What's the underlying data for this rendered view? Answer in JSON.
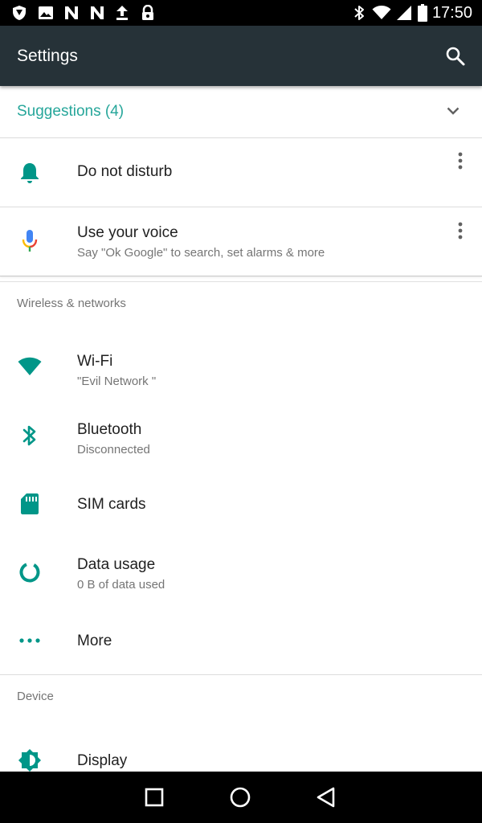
{
  "status_bar": {
    "time": "17:50",
    "left_icons": [
      "shield-icon",
      "image-icon",
      "n-notification-icon",
      "n-notification-icon",
      "upload-icon",
      "lock-icon"
    ],
    "right_icons": [
      "bluetooth-icon",
      "wifi-icon",
      "signal-icon",
      "battery-icon"
    ]
  },
  "app_bar": {
    "title": "Settings",
    "search_icon": "search-icon"
  },
  "suggestions": {
    "label": "Suggestions (4)",
    "items": [
      {
        "title": "Do not disturb",
        "icon": "bell-icon"
      },
      {
        "title": "Use your voice",
        "subtitle": "Say \"Ok Google\" to search, set alarms & more",
        "icon": "microphone-icon"
      }
    ]
  },
  "sections": [
    {
      "header": "Wireless & networks",
      "items": [
        {
          "title": "Wi-Fi",
          "subtitle": "\"Evil Network \"",
          "icon": "wifi-icon"
        },
        {
          "title": "Bluetooth",
          "subtitle": "Disconnected",
          "icon": "bluetooth-icon"
        },
        {
          "title": "SIM cards",
          "icon": "sim-card-icon"
        },
        {
          "title": "Data usage",
          "subtitle": "0 B of data used",
          "icon": "data-usage-icon"
        },
        {
          "title": "More",
          "icon": "more-horizontal-icon"
        }
      ]
    },
    {
      "header": "Device",
      "items": [
        {
          "title": "Display",
          "icon": "brightness-icon"
        }
      ]
    }
  ],
  "nav_bar": {
    "buttons": [
      "recents-icon",
      "home-icon",
      "back-icon"
    ]
  },
  "colors": {
    "accent": "#26a69a",
    "icon_teal": "#009688",
    "app_bar": "#263238",
    "status_bar": "#000000"
  }
}
